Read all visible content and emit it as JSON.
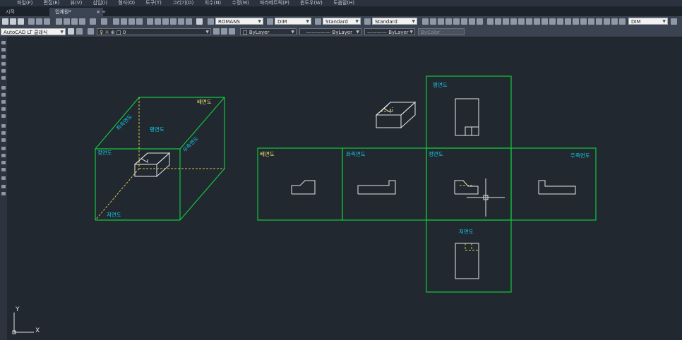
{
  "menu": [
    "파일(F)",
    "편집(E)",
    "뷰(V)",
    "삽입(I)",
    "형식(O)",
    "도구(T)",
    "그리기(D)",
    "치수(N)",
    "수정(M)",
    "파라메트릭(P)",
    "윈도우(W)",
    "도움말(H)"
  ],
  "tabs": {
    "home": "시작",
    "active": "입체원*",
    "add": "+"
  },
  "toolbar": {
    "text_style": "ROMANS",
    "dim_style": "DIM",
    "table_style": "Standard",
    "multileader_style": "Standard",
    "dim_style_right": "DIM",
    "workspace": "AutoCAD LT 클래식",
    "layer": "0",
    "color": "ByLayer",
    "linetype": "ByLayer",
    "lineweight": "ByLayer",
    "plot_style": "ByColor"
  },
  "drawing": {
    "iso": {
      "back_label": "배면도",
      "left_label": "좌측면도",
      "top_label": "평면도",
      "right_label": "우측면도",
      "front_label": "정면도",
      "bottom_label": "저면도"
    },
    "unfolded": {
      "top_label": "평면도",
      "back_label": "배면도",
      "left_label": "좌측면도",
      "front_label": "정면도",
      "right_label": "우측면도",
      "bottom_label": "저면도"
    },
    "ucs": {
      "x": "X",
      "y": "Y"
    }
  },
  "colors": {
    "background": "#212830",
    "frame_green": "#12c63c",
    "label_cyan": "#17c8e6",
    "label_yellow": "#f2e46a",
    "hidden_line": "#d8c34a",
    "object_line": "#e6e6e6"
  }
}
